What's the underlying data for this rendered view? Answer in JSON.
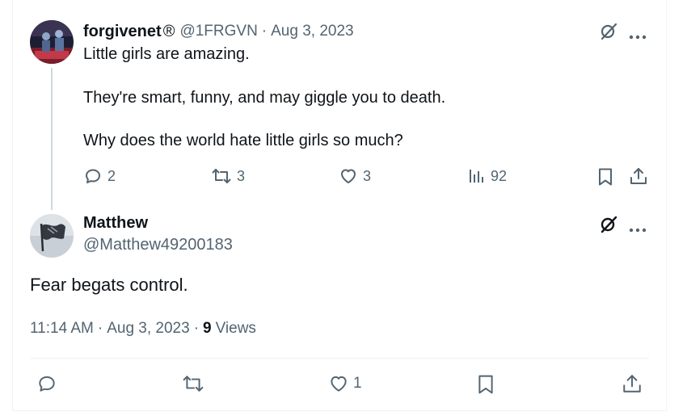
{
  "parent_tweet": {
    "display_name": "forgivenet",
    "name_symbol": "®",
    "handle": "@1FRGVN",
    "separator": "·",
    "date": "Aug 3, 2023",
    "lines": [
      "Little girls are amazing.",
      "They're smart, funny, and may giggle you to death.",
      "Why does the world hate little girls so much?"
    ],
    "actions": {
      "replies": "2",
      "reposts": "3",
      "likes": "3",
      "views": "92"
    }
  },
  "main_tweet": {
    "display_name": "Matthew",
    "handle": "@Matthew49200183",
    "text": "Fear begats control.",
    "time": "11:14 AM",
    "separator": "·",
    "date": "Aug 3, 2023",
    "separator2": "·",
    "views_count": "9",
    "views_label": "Views",
    "actions": {
      "likes": "1"
    }
  },
  "colors": {
    "text_primary": "#0f1419",
    "text_muted": "#536471",
    "border": "#eff3f4",
    "thread_line": "#cfd9de"
  },
  "icons": {
    "grok": "grok-slash-icon",
    "more": "more-dots-icon",
    "reply": "reply-icon",
    "repost": "repost-icon",
    "like": "heart-icon",
    "views": "views-bars-icon",
    "bookmark": "bookmark-icon",
    "share": "share-icon"
  }
}
